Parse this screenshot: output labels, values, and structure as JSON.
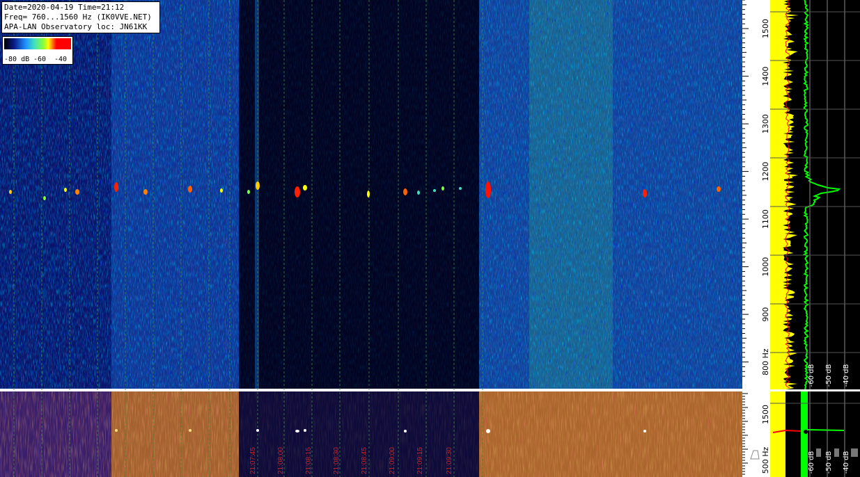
{
  "header": {
    "line1": "Date=2020-04-19 Time=21:12",
    "line2": "Freq= 760...1560 Hz (IK0VVE.NET)",
    "line3": "APA-LAN Observatory loc: JN61KK"
  },
  "legend": {
    "labels": [
      "-80 dB",
      "-60",
      "-40"
    ],
    "gradient_colors": [
      "#000000",
      "#0a1a8a",
      "#1e90ff",
      "#3fe0c0",
      "#80ff40",
      "#ffff00",
      "#ff8000",
      "#ff0000",
      "#ff0000"
    ]
  },
  "freq_axis": {
    "labels": [
      "1500",
      "1400",
      "1300",
      "1200",
      "1100",
      "1000",
      "900",
      "800 Hz"
    ]
  },
  "lower_freq_axis": {
    "labels": [
      "1500",
      "500 Hz"
    ]
  },
  "spectrum_axis": {
    "labels": [
      "-60 dB",
      "-50 dB",
      "-40 dB"
    ]
  },
  "lower_spectrum_axis": {
    "labels": [
      "-60 dB",
      "-50 dB",
      "-40 dB"
    ]
  },
  "time_labels": [
    "21:07:45",
    "21:08:00",
    "21:08:15",
    "21:08:30",
    "21:08:45",
    "21:09:00",
    "21:09:15",
    "21:09:30"
  ],
  "colors": {
    "background": "#000000",
    "spectrum_avg": "#ffff00",
    "spectrum_peak": "#00ff00",
    "grid": "#3c8c3c",
    "time_label": "#cc2222"
  }
}
